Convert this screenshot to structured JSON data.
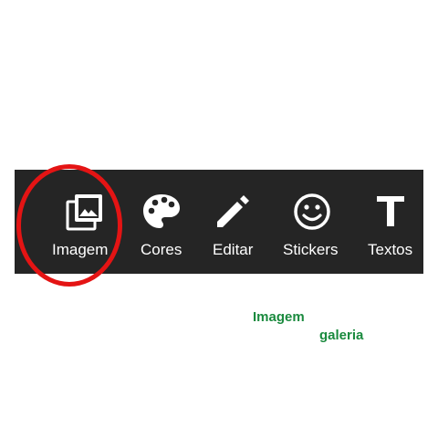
{
  "toolbar": {
    "background": "#252525",
    "items": [
      {
        "label": "Imagem",
        "icon": "photo-library-icon"
      },
      {
        "label": "Cores",
        "icon": "palette-icon"
      },
      {
        "label": "Editar",
        "icon": "pencil-icon"
      },
      {
        "label": "Stickers",
        "icon": "smiley-icon"
      },
      {
        "label": "Textos",
        "icon": "text-t-icon"
      }
    ]
  },
  "highlight": {
    "color": "#e41414",
    "target": "Imagem"
  },
  "captions": {
    "color": "#1a8a3e",
    "line1": "Imagem",
    "line2": "galeria"
  }
}
